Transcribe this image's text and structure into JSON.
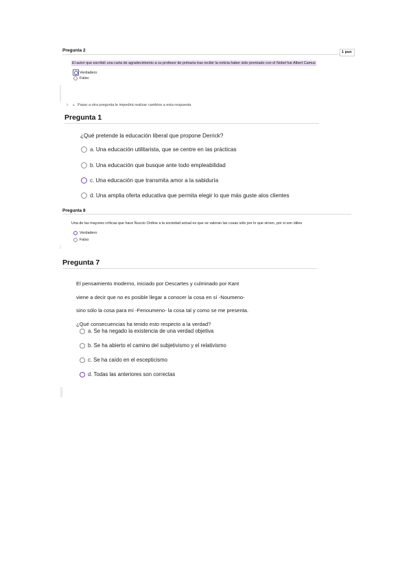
{
  "q2": {
    "title": "Pregunta 2",
    "points": "1 pun",
    "text": "El autor que escribió una carta de agradecimiento a su profesor de primaria tras recibir la noticia haber sido premiado con el Nobel fue Albert Camus",
    "options": [
      {
        "label": "Verdadero",
        "selected": true
      },
      {
        "label": "Falso",
        "selected": false
      }
    ],
    "warning": "Pasar a otra pregunta le impedirá realizar cambios a esta respuesta"
  },
  "q1": {
    "title": "Pregunta 1",
    "text": "¿Qué pretende la educación liberal que propone Derrick?",
    "options": [
      {
        "letter": "a.",
        "label": "Una educación utilitarista, que se centre en las prácticas",
        "selected": false
      },
      {
        "letter": "b.",
        "label": "Una educación que busque ante todo empleabilidad",
        "selected": false
      },
      {
        "letter": "c.",
        "label": "Una educación que transmita amor a la sabiduría",
        "selected": true
      },
      {
        "letter": "d.",
        "label": "Una amplia oferta educativa que permita elegir lo que más guste alos clientes",
        "selected": false
      }
    ]
  },
  "q8": {
    "title": "Pregunta 8",
    "text": "Una de las mayores críticas que hace Nuccio Ordine a la sociedad actual es que se valoran las cosas sólo por lo que sirven, por si son útiles",
    "options": [
      {
        "label": "Verdadero",
        "selected": true
      },
      {
        "label": "Falso",
        "selected": false
      }
    ]
  },
  "q7": {
    "title": "Pregunta 7",
    "text_lines": [
      "El pensamiento moderno, iniciado por Descartes y culminado por Kant",
      "viene a decir que no es posible llegar a conocer la cosa en sí -Noumeno-",
      "sino sólo la cosa para mí -Fenoumeno- la cosa tal y como se me presenta.",
      "¿Qué consecuencias ha tenido esto respecto a la verdad?"
    ],
    "options": [
      {
        "letter": "a.",
        "label": "Se ha negado la existencia de una verdad objetiva",
        "selected": false
      },
      {
        "letter": "b.",
        "label": "Se ha abierto el camino del subjetivismo y el relativismo",
        "selected": false
      },
      {
        "letter": "c.",
        "label": "Se ha caído en el escepticismo",
        "selected": false
      },
      {
        "letter": "d.",
        "label": "Todas las anteriores son correctas",
        "selected": true
      }
    ]
  },
  "colors": {
    "accent": "#7a3fb0",
    "highlight": "#e6d6f2",
    "warning": "#e8a33d"
  }
}
